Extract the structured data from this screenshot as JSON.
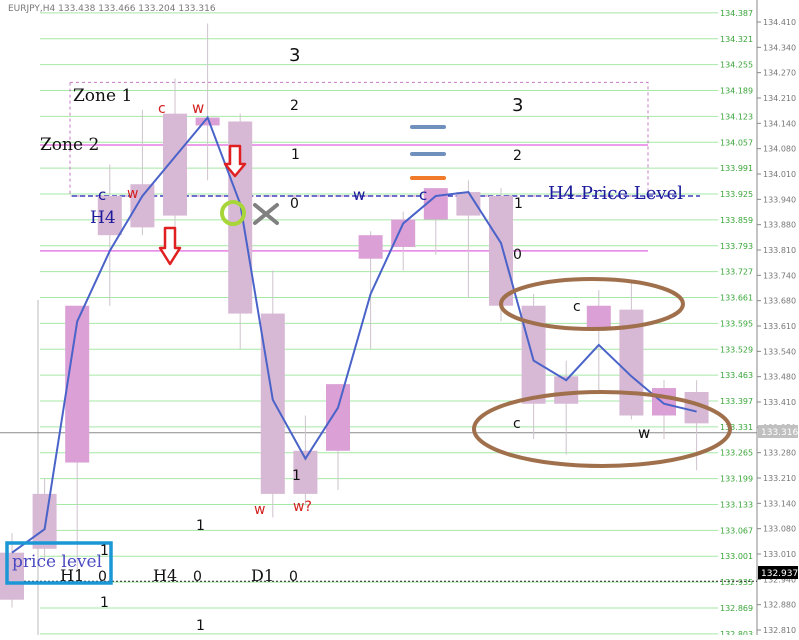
{
  "chart_data": {
    "type": "candlestick",
    "title": "EURJPY,H4  133.438 133.466 133.204 133.316",
    "ylim": [
      132.8,
      134.42
    ],
    "green_levels": [
      134.387,
      134.321,
      134.255,
      134.189,
      134.123,
      134.057,
      133.991,
      133.925,
      133.859,
      133.793,
      133.727,
      133.661,
      133.595,
      133.529,
      133.463,
      133.397,
      133.331,
      133.265,
      133.199,
      133.133,
      133.067,
      133.001,
      132.935,
      132.869,
      132.803
    ],
    "axis_ticks": [
      "134.410",
      "134.340",
      "134.270",
      "134.210",
      "134.140",
      "134.080",
      "134.010",
      "133.940",
      "133.880",
      "133.810",
      "133.740",
      "133.680",
      "133.610",
      "133.540",
      "133.480",
      "133.410",
      "133.350",
      "133.280",
      "133.210",
      "133.140",
      "133.080",
      "133.010",
      "132.940",
      "132.880",
      "132.810"
    ],
    "current_price": "133.316",
    "marker_price": "132.937",
    "zone1_top": 134.21,
    "zone2_top": 134.05,
    "h4_level": 133.92,
    "zero_level": 133.78,
    "current_level": 133.316,
    "dotted_level": 132.937,
    "candles": [
      {
        "o": 133.01,
        "h": 133.06,
        "l": 132.87,
        "c": 132.89
      },
      {
        "o": 133.16,
        "h": 133.2,
        "l": 132.99,
        "c": 133.02
      },
      {
        "o": 133.24,
        "h": 133.58,
        "l": 132.96,
        "c": 133.64
      },
      {
        "o": 133.92,
        "h": 134.0,
        "l": 133.64,
        "c": 133.82
      },
      {
        "o": 133.95,
        "h": 134.14,
        "l": 133.82,
        "c": 133.84
      },
      {
        "o": 134.13,
        "h": 134.22,
        "l": 133.84,
        "c": 133.87
      },
      {
        "o": 134.1,
        "h": 134.36,
        "l": 133.96,
        "c": 134.12
      },
      {
        "o": 134.11,
        "h": 134.13,
        "l": 133.53,
        "c": 133.62
      },
      {
        "o": 133.62,
        "h": 133.73,
        "l": 133.1,
        "c": 133.16
      },
      {
        "o": 133.27,
        "h": 133.36,
        "l": 133.13,
        "c": 133.16
      },
      {
        "o": 133.27,
        "h": 133.44,
        "l": 133.17,
        "c": 133.44
      },
      {
        "o": 133.76,
        "h": 133.83,
        "l": 133.53,
        "c": 133.82
      },
      {
        "o": 133.79,
        "h": 133.88,
        "l": 133.73,
        "c": 133.86
      },
      {
        "o": 133.86,
        "h": 133.94,
        "l": 133.77,
        "c": 133.94
      },
      {
        "o": 133.93,
        "h": 133.96,
        "l": 133.66,
        "c": 133.87
      },
      {
        "o": 133.92,
        "h": 133.94,
        "l": 133.6,
        "c": 133.64
      },
      {
        "o": 133.64,
        "h": 133.67,
        "l": 133.3,
        "c": 133.39
      },
      {
        "o": 133.46,
        "h": 133.5,
        "l": 133.26,
        "c": 133.39
      },
      {
        "o": 133.58,
        "h": 133.68,
        "l": 133.42,
        "c": 133.64
      },
      {
        "o": 133.63,
        "h": 133.7,
        "l": 133.35,
        "c": 133.36
      },
      {
        "o": 133.36,
        "h": 133.45,
        "l": 133.3,
        "c": 133.43
      },
      {
        "o": 133.42,
        "h": 133.45,
        "l": 133.22,
        "c": 133.34
      }
    ],
    "wave_line": [
      133.01,
      133.07,
      133.6,
      133.78,
      133.92,
      134.02,
      134.12,
      133.9,
      133.4,
      133.25,
      133.38,
      133.67,
      133.85,
      133.92,
      133.93,
      133.8,
      133.5,
      133.45,
      133.54,
      133.46,
      133.39,
      133.37
    ]
  },
  "zones": {
    "zone1": "Zone 1",
    "zone2": "Zone 2",
    "h4": "H4",
    "h4_price_level": "H4 Price Level"
  },
  "bottom": {
    "price_level": "price level",
    "h1": "H1",
    "h4": "H4",
    "d1": "D1",
    "zero": "0",
    "one": "1"
  },
  "counts": {
    "three": "3",
    "two": "2",
    "one": "1",
    "zero": "0"
  },
  "wave_labels": {
    "c": "c",
    "w": "w",
    "w_q": "w?"
  },
  "colors": {
    "bull": "#dba0d6",
    "bear": "#d7b8d5",
    "wave": "#4a63c9",
    "grid": "#a6e8a6",
    "magenta": "#e77fe4",
    "blue_dash": "#1717b2",
    "ellipse": "#a0704c",
    "lime": "#a7d53a",
    "red": "#e02020",
    "bracket_blue": "#1a97d4"
  }
}
